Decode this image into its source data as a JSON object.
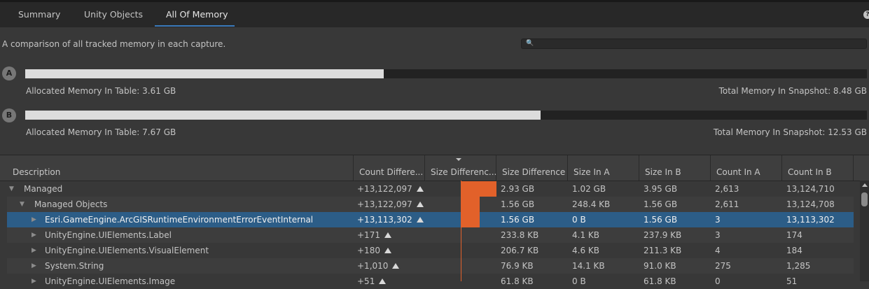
{
  "tabs": [
    {
      "label": "Summary"
    },
    {
      "label": "Unity Objects"
    },
    {
      "label": "All Of Memory"
    }
  ],
  "description": "A comparison of all tracked memory in each capture.",
  "search": {
    "placeholder": ""
  },
  "captures": [
    {
      "badge": "A",
      "allocated": "Allocated Memory In Table: 3.61 GB",
      "total": "Total Memory In Snapshot: 8.48 GB",
      "fraction": 0.4257
    },
    {
      "badge": "B",
      "allocated": "Allocated Memory In Table: 7.67 GB",
      "total": "Total Memory In Snapshot: 12.53 GB",
      "fraction": 0.6121
    }
  ],
  "columns": [
    "Description",
    "Count Differe...",
    "Size Differenc...",
    "Size Difference",
    "Size In A",
    "Size In B",
    "Count In A",
    "Count In B"
  ],
  "rows": [
    {
      "name": "Managed",
      "count_diff": "+13,122,097",
      "size_diff": "2.93 GB",
      "size_a": "1.02 GB",
      "size_b": "3.95 GB",
      "count_a": "2,613",
      "count_b": "13,124,710",
      "size_ratio": 1.0
    },
    {
      "name": "Managed Objects",
      "count_diff": "+13,122,097",
      "size_diff": "1.56 GB",
      "size_a": "248.4 KB",
      "size_b": "1.56 GB",
      "count_a": "2,611",
      "count_b": "13,124,708",
      "size_ratio": 0.53
    },
    {
      "name": "Esri.GameEngine.ArcGISRuntimeEnvironmentErrorEventInternal",
      "count_diff": "+13,113,302",
      "size_diff": "1.56 GB",
      "size_a": "0 B",
      "size_b": "1.56 GB",
      "count_a": "3",
      "count_b": "13,113,302",
      "size_ratio": 0.53
    },
    {
      "name": "UnityEngine.UIElements.Label",
      "count_diff": "+171",
      "size_diff": "233.8 KB",
      "size_a": "4.1 KB",
      "size_b": "237.9 KB",
      "count_a": "3",
      "count_b": "174",
      "size_ratio": 0.0
    },
    {
      "name": "UnityEngine.UIElements.VisualElement",
      "count_diff": "+180",
      "size_diff": "206.7 KB",
      "size_a": "4.6 KB",
      "size_b": "211.3 KB",
      "count_a": "4",
      "count_b": "184",
      "size_ratio": 0.0
    },
    {
      "name": "System.String",
      "count_diff": "+1,010",
      "size_diff": "76.9 KB",
      "size_a": "14.1 KB",
      "size_b": "91.0 KB",
      "count_a": "275",
      "count_b": "1,285",
      "size_ratio": 0.0
    },
    {
      "name": "UnityEngine.UIElements.Image",
      "count_diff": "+51",
      "size_diff": "61.8 KB",
      "size_a": "0 B",
      "size_b": "61.8 KB",
      "count_a": "0",
      "count_b": "51",
      "size_ratio": 0.0
    }
  ]
}
